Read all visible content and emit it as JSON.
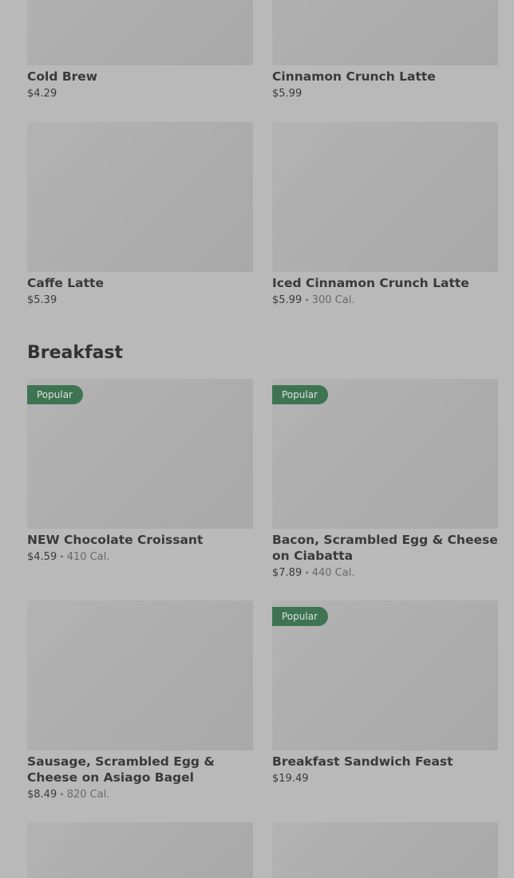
{
  "coffee": {
    "items": [
      {
        "name": "Cold Brew",
        "price": "$4.29"
      },
      {
        "name": "Cinnamon Crunch Latte",
        "price": "$5.99"
      },
      {
        "name": "Caffe Latte",
        "price": "$5.39"
      },
      {
        "name": "Iced Cinnamon Crunch Latte",
        "price": "$5.99",
        "calories": "300 Cal."
      }
    ]
  },
  "breakfast": {
    "title": "Breakfast",
    "items": [
      {
        "badge": "Popular",
        "name": "NEW Chocolate Croissant",
        "price": "$4.59",
        "calories": "410 Cal."
      },
      {
        "badge": "Popular",
        "name": "Bacon, Scrambled Egg & Cheese on Ciabatta",
        "price": "$7.89",
        "calories": "440 Cal."
      },
      {
        "name": "Sausage, Scrambled Egg & Cheese on Asiago Bagel",
        "price": "$8.49",
        "calories": "820 Cal."
      },
      {
        "badge": "Popular",
        "name": "Breakfast Sandwich Feast",
        "price": "$19.49"
      }
    ]
  },
  "separator": "•",
  "colors": {
    "overlay": "#b9b9b9",
    "badge_bg": "#3f7452",
    "text": "#3a3a3a",
    "muted": "#6a6a6a"
  }
}
